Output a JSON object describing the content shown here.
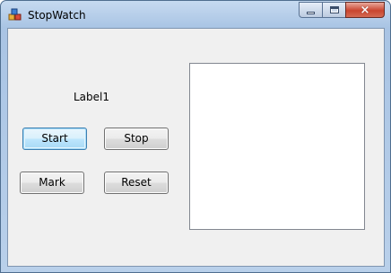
{
  "window": {
    "title": "StopWatch",
    "icon": "app-icon",
    "controls": {
      "minimize": "minimize-icon",
      "maximize": "maximize-icon",
      "close": "×"
    }
  },
  "form": {
    "label": "Label1",
    "buttons": {
      "start": "Start",
      "stop": "Stop",
      "mark": "Mark",
      "reset": "Reset"
    },
    "listbox_items": []
  },
  "colors": {
    "form_background": "#f0f0f0",
    "titlebar": "#b9d0ea",
    "close_button": "#c9452f"
  }
}
